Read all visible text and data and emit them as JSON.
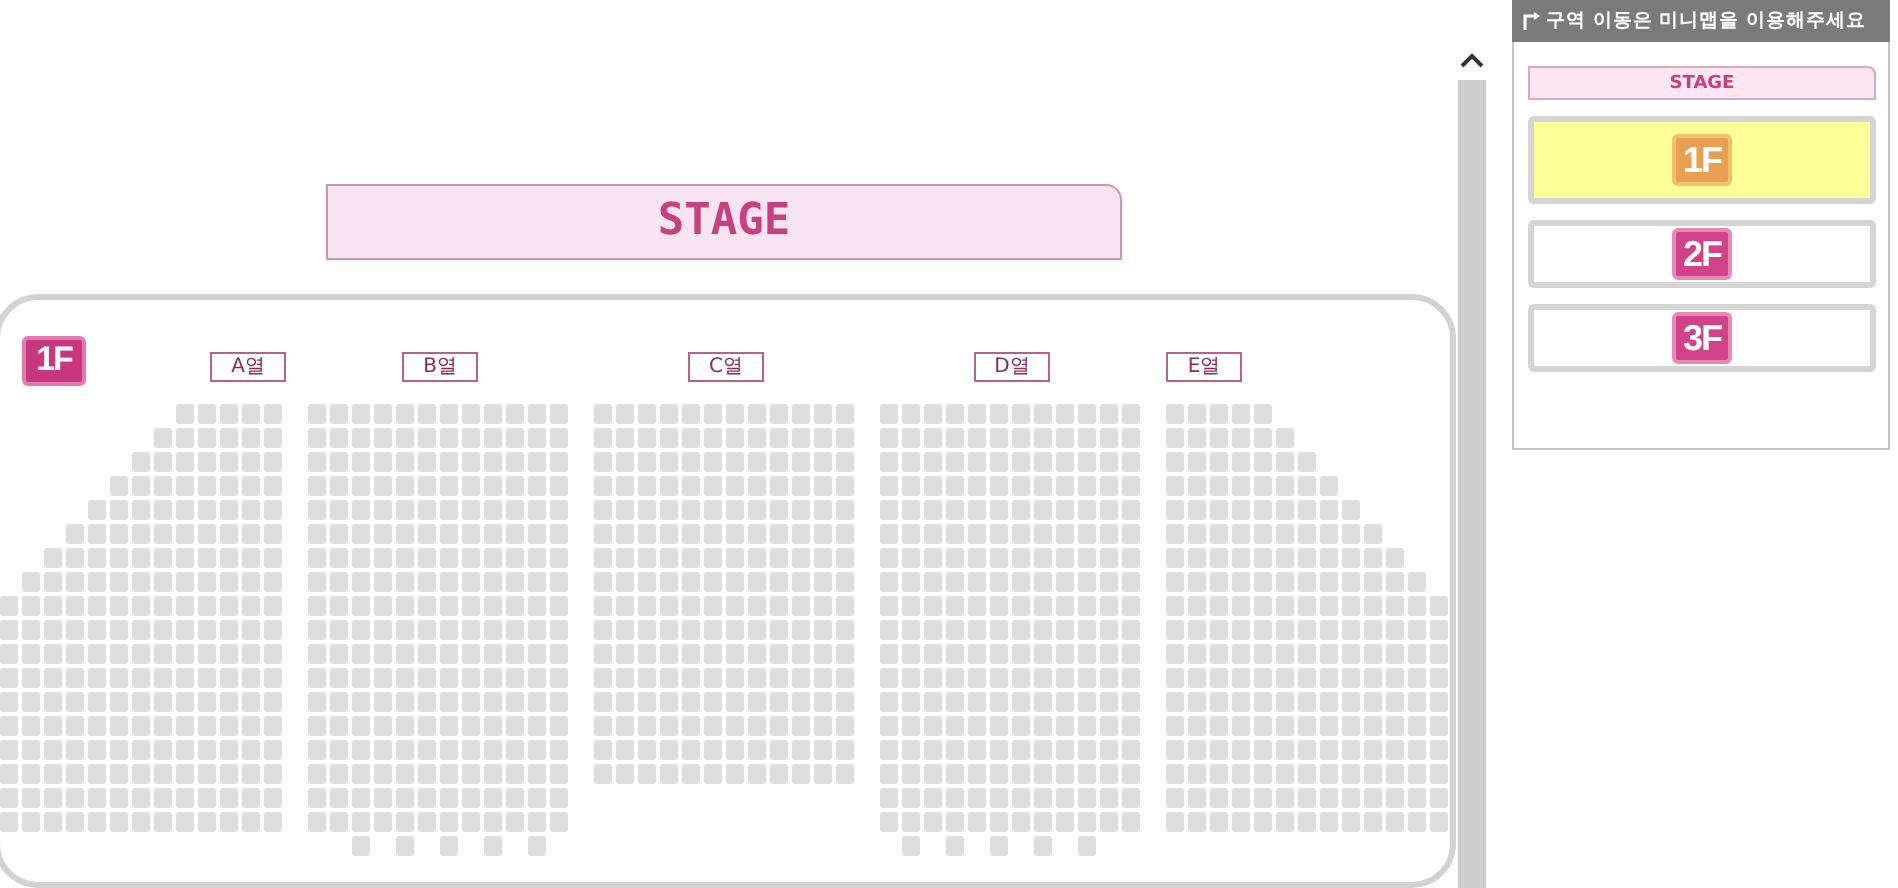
{
  "seat_map": {
    "stage": "STAGE",
    "floor_badge": "1F",
    "sections": [
      {
        "label": "A열",
        "kind": "stair-left"
      },
      {
        "label": "B열",
        "kind": "block"
      },
      {
        "label": "C열",
        "kind": "block"
      },
      {
        "label": "D열",
        "kind": "block"
      },
      {
        "label": "E열",
        "kind": "stair-right"
      }
    ]
  },
  "minimap": {
    "header": "구역 이동은 미니맵을 이용해주세요",
    "stage": "STAGE",
    "floors": [
      {
        "label": "1F",
        "selected": true
      },
      {
        "label": "2F",
        "selected": false
      },
      {
        "label": "3F",
        "selected": false
      }
    ]
  }
}
